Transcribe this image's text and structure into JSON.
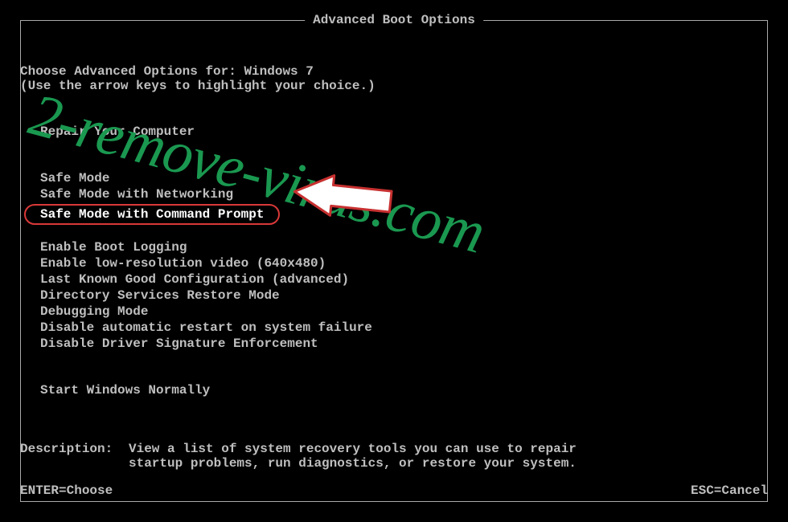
{
  "title": "Advanced Boot Options",
  "subtitle": "Choose Advanced Options for: Windows 7",
  "hint": "(Use the arrow keys to highlight your choice.)",
  "repair": "Repair Your Computer",
  "menu": {
    "safe_mode": "Safe Mode",
    "safe_mode_net": "Safe Mode with Networking",
    "safe_mode_cmd": "Safe Mode with Command Prompt",
    "boot_logging": "Enable Boot Logging",
    "low_res": "Enable low-resolution video (640x480)",
    "last_known": "Last Known Good Configuration (advanced)",
    "dsrm": "Directory Services Restore Mode",
    "debugging": "Debugging Mode",
    "disable_restart": "Disable automatic restart on system failure",
    "disable_driver_sig": "Disable Driver Signature Enforcement",
    "start_normally": "Start Windows Normally"
  },
  "description_label": "Description:",
  "description_text": "View a list of system recovery tools you can use to repair startup problems, run diagnostics, or restore your system.",
  "footer": {
    "enter": "ENTER=Choose",
    "esc": "ESC=Cancel"
  },
  "watermark": "2-remove-virus.com"
}
